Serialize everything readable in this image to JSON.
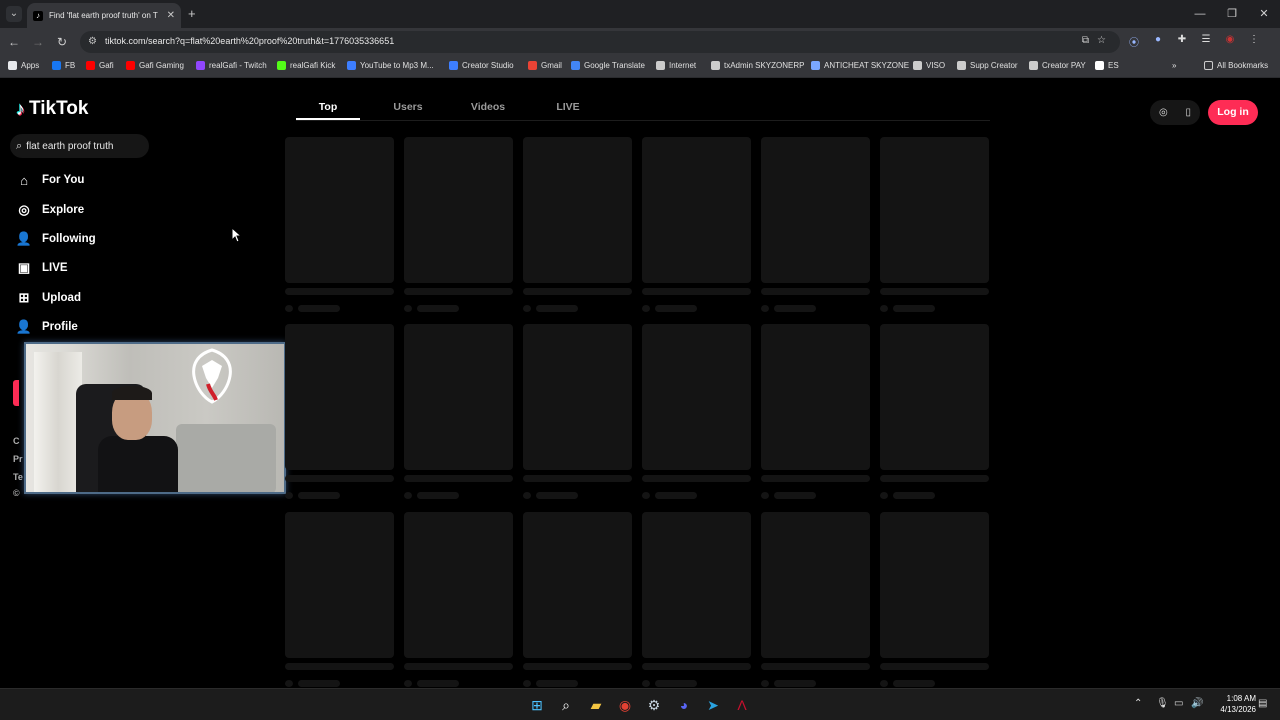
{
  "browser": {
    "tab_title": "Find 'flat earth proof truth' on T",
    "tab_close": "✕",
    "new_tab": "+",
    "url": "tiktok.com/search?q=flat%20earth%20proof%20truth&t=1776035336651",
    "bookmarks": [
      {
        "label": "Apps",
        "color": "#e8eaed"
      },
      {
        "label": "FB",
        "color": "#1877f2"
      },
      {
        "label": "Gafi",
        "color": "#ff0000"
      },
      {
        "label": "Gafi Gaming",
        "color": "#ff0000"
      },
      {
        "label": "realGafi - Twitch",
        "color": "#9146ff"
      },
      {
        "label": "realGafi Kick",
        "color": "#53fc18"
      },
      {
        "label": "YouTube to Mp3 M...",
        "color": "#3d7eff"
      },
      {
        "label": "Creator Studio",
        "color": "#3d7eff"
      },
      {
        "label": "Gmail",
        "color": "#ea4335"
      },
      {
        "label": "Google Translate",
        "color": "#4285f4"
      },
      {
        "label": "Internet",
        "color": "#cccccc"
      },
      {
        "label": "txAdmin SKYZONERP",
        "color": "#cccccc"
      },
      {
        "label": "ANTICHEAT SKYZONE",
        "color": "#7aa7ff"
      },
      {
        "label": "VISO",
        "color": "#cccccc"
      },
      {
        "label": "Supp Creator",
        "color": "#cccccc"
      },
      {
        "label": "Creator PAY",
        "color": "#cccccc"
      },
      {
        "label": "ES",
        "color": "#ffffff"
      }
    ],
    "all_bookmarks": "All Bookmarks",
    "more_bookmarks": "»"
  },
  "tiktok": {
    "brand": "TikTok",
    "search_value": "flat earth proof truth",
    "nav": [
      {
        "label": "For You",
        "icon": "home-icon",
        "glyph": "⌂"
      },
      {
        "label": "Explore",
        "icon": "compass-icon",
        "glyph": "◎"
      },
      {
        "label": "Following",
        "icon": "user-follow-icon",
        "glyph": "👤"
      },
      {
        "label": "LIVE",
        "icon": "live-tv-icon",
        "glyph": "▣"
      },
      {
        "label": "Upload",
        "icon": "upload-icon",
        "glyph": "⊞"
      },
      {
        "label": "Profile",
        "icon": "profile-icon",
        "glyph": "👤"
      }
    ],
    "footer_stubs": [
      "C",
      "Pr",
      "Te",
      "©"
    ],
    "tabs": [
      "Top",
      "Users",
      "Videos",
      "LIVE"
    ],
    "active_tab": "Top",
    "login_label": "Log in",
    "accent": "#fe2c55"
  },
  "taskbar": {
    "time": "1:08 AM",
    "date": "4/13/2026",
    "apps": [
      {
        "name": "windows-start-icon",
        "glyph": "⊞",
        "color": "#4cc2ff"
      },
      {
        "name": "search-icon",
        "glyph": "⌕",
        "color": "#ffffff"
      },
      {
        "name": "file-explorer-icon",
        "glyph": "▰",
        "color": "#f4c542"
      },
      {
        "name": "chrome-icon",
        "glyph": "◉",
        "color": "#e34133"
      },
      {
        "name": "steam-icon",
        "glyph": "⚙",
        "color": "#c7d5e0"
      },
      {
        "name": "discord-icon",
        "glyph": "◕",
        "color": "#5865f2"
      },
      {
        "name": "telegram-icon",
        "glyph": "➤",
        "color": "#2aa3e0"
      },
      {
        "name": "app-red-icon",
        "glyph": "Λ",
        "color": "#c8102e"
      }
    ]
  }
}
